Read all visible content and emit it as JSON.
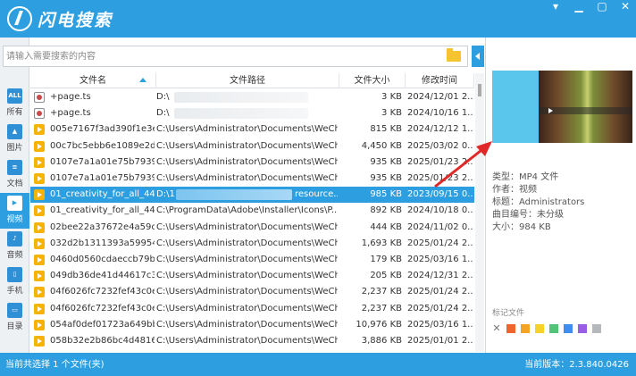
{
  "app": {
    "title": "闪电搜索"
  },
  "window": {
    "minimize": "▁",
    "maximize": "▢",
    "close": "✕",
    "pin": "▾"
  },
  "sidebar": {
    "items": [
      {
        "label": "所有",
        "icon": "ALL"
      },
      {
        "label": "图片",
        "icon": "▲"
      },
      {
        "label": "文档",
        "icon": "≡"
      },
      {
        "label": "视频",
        "icon": "▶"
      },
      {
        "label": "音频",
        "icon": "♪"
      },
      {
        "label": "手机",
        "icon": "▯"
      },
      {
        "label": "目录",
        "icon": "▭"
      }
    ],
    "active_index": 3
  },
  "search": {
    "placeholder": "请输入需要搜索的内容",
    "value": ""
  },
  "table": {
    "columns": [
      "文件名",
      "文件路径",
      "文件大小",
      "修改时间"
    ],
    "rows": [
      {
        "name": "+page.ts",
        "path": "D:\\",
        "size": "3 KB",
        "time": "2024/12/01 2...",
        "type": "ts"
      },
      {
        "name": "+page.ts",
        "path": "D:\\",
        "size": "3 KB",
        "time": "2024/10/16 1...",
        "type": "ts"
      },
      {
        "name": "005e7167f3ad390f1e3e...",
        "path": "C:\\Users\\Administrator\\Documents\\WeCh...",
        "size": "815 KB",
        "time": "2024/12/12 1...",
        "type": "vid"
      },
      {
        "name": "00c7bc5ebb6e1089e2d...",
        "path": "C:\\Users\\Administrator\\Documents\\WeCh...",
        "size": "4,450 KB",
        "time": "2025/03/02 0...",
        "type": "vid"
      },
      {
        "name": "0107e7a1a01e75b7939...",
        "path": "C:\\Users\\Administrator\\Documents\\WeCh...",
        "size": "935 KB",
        "time": "2025/01/23 2...",
        "type": "vid"
      },
      {
        "name": "0107e7a1a01e75b7939...",
        "path": "C:\\Users\\Administrator\\Documents\\WeCh...",
        "size": "935 KB",
        "time": "2025/01/23 2...",
        "type": "vid"
      },
      {
        "name": "01_creativity_for_all_445...",
        "path": "D:\\1",
        "path_tail": "resource...",
        "size": "985 KB",
        "time": "2023/09/15 0...",
        "type": "vid",
        "selected": true
      },
      {
        "name": "01_creativity_for_all_445...",
        "path": "C:\\ProgramData\\Adobe\\Installer\\Icons\\P...",
        "size": "892 KB",
        "time": "2024/10/18 0...",
        "type": "vid"
      },
      {
        "name": "02bee22a37672e4a59c...",
        "path": "C:\\Users\\Administrator\\Documents\\WeCh...",
        "size": "444 KB",
        "time": "2024/11/02 0...",
        "type": "vid"
      },
      {
        "name": "032d2b1311393a59954...",
        "path": "C:\\Users\\Administrator\\Documents\\WeCh...",
        "size": "1,693 KB",
        "time": "2025/01/24 2...",
        "type": "vid"
      },
      {
        "name": "0460d0560cdaeccb79b...",
        "path": "C:\\Users\\Administrator\\Documents\\WeCh...",
        "size": "179 KB",
        "time": "2025/03/16 1...",
        "type": "vid"
      },
      {
        "name": "049db36de41d44617c3...",
        "path": "C:\\Users\\Administrator\\Documents\\WeCh...",
        "size": "205 KB",
        "time": "2024/12/31 2...",
        "type": "vid"
      },
      {
        "name": "04f6026fc7232fef43c0e...",
        "path": "C:\\Users\\Administrator\\Documents\\WeCh...",
        "size": "2,237 KB",
        "time": "2025/01/24 2...",
        "type": "vid"
      },
      {
        "name": "04f6026fc7232fef43c0e...",
        "path": "C:\\Users\\Administrator\\Documents\\WeCh...",
        "size": "2,237 KB",
        "time": "2025/01/24 2...",
        "type": "vid"
      },
      {
        "name": "054af0def01723a649bb...",
        "path": "C:\\Users\\Administrator\\Documents\\WeCh...",
        "size": "10,976 KB",
        "time": "2025/03/16 1...",
        "type": "vid"
      },
      {
        "name": "058b32e2b86bc4d4816...",
        "path": "C:\\Users\\Administrator\\Documents\\WeCh...",
        "size": "3,886 KB",
        "time": "2025/01/01 2...",
        "type": "vid"
      }
    ]
  },
  "details": {
    "type": "类型：MP4 文件",
    "author": "作者：视频",
    "tag": "标题：Administrators",
    "track": "曲目编号：未分级",
    "size": "大小：984 KB"
  },
  "tags": {
    "title": "标记文件",
    "clear": "✕",
    "colors": [
      "#f0652f",
      "#f4a425",
      "#f6d12a",
      "#52c47a",
      "#3d8ef0",
      "#9b5de5",
      "#b5b8bc"
    ]
  },
  "status": {
    "left": "当前共选择 1 个文件(夹)",
    "right": "当前版本：2.3.840.0426"
  },
  "colors": {
    "accent": "#2d9fe0",
    "file_icon": "#f4b400"
  }
}
